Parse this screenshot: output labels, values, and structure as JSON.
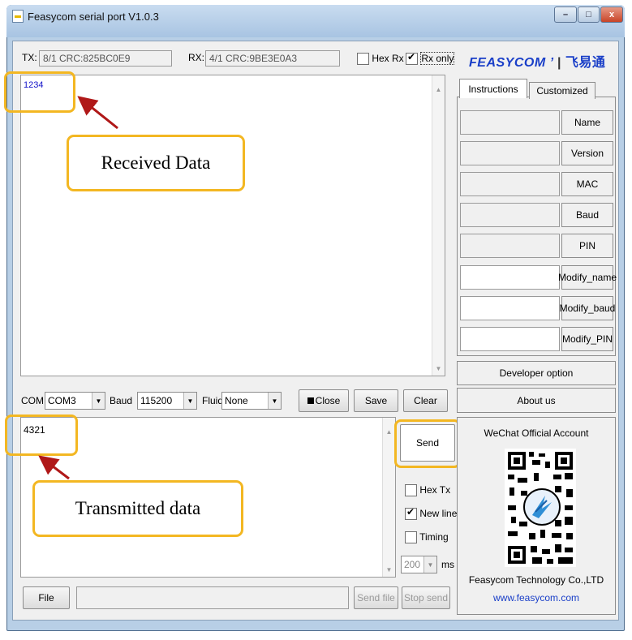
{
  "window": {
    "title": "Feasycom serial port V1.0.3",
    "min": "–",
    "max": "□",
    "close": "x"
  },
  "stats": {
    "tx_label": "TX:",
    "tx_value": "8/1 CRC:825BC0E9",
    "rx_label": "RX:",
    "rx_value": "4/1 CRC:9BE3E0A3",
    "hex_rx": "Hex Rx",
    "hex_rx_checked": false,
    "rx_only": "Rx only",
    "rx_only_checked": true
  },
  "brand": {
    "logo": "FEASYCOM",
    "logo_cn": "飞易通"
  },
  "received": {
    "text": "1234",
    "color": "#1010c8"
  },
  "transmit": {
    "text": "4321"
  },
  "serial": {
    "com_label": "COM",
    "com_value": "COM3",
    "baud_label": "Baud",
    "baud_value": "115200",
    "fluid_label": "Fluid",
    "fluid_value": "None",
    "close_btn": "Close",
    "save_btn": "Save",
    "clear_btn": "Clear"
  },
  "send": {
    "send_btn": "Send",
    "hex_tx": "Hex Tx",
    "hex_tx_checked": false,
    "new_line": "New line",
    "new_line_checked": true,
    "timing": "Timing",
    "timing_checked": false,
    "interval": "200",
    "unit": "ms"
  },
  "bottom": {
    "file_btn": "File",
    "send_file_btn": "Send file",
    "stop_send_btn": "Stop send"
  },
  "tabs": [
    "Instructions",
    "Customized"
  ],
  "instructions": [
    {
      "label": "Name"
    },
    {
      "label": "Version"
    },
    {
      "label": "MAC"
    },
    {
      "label": "Baud"
    },
    {
      "label": "PIN"
    },
    {
      "label": "Modify_name"
    },
    {
      "label": "Modify_baud"
    },
    {
      "label": "Modify_PIN"
    }
  ],
  "sidebar": {
    "developer": "Developer option",
    "about": "About us"
  },
  "wechat": {
    "title": "WeChat Official Account",
    "company": "Feasycom Technology Co.,LTD",
    "url": "www.feasycom.com",
    "url_color": "#1a3fc8"
  },
  "annotations": {
    "received": "Received Data",
    "transmitted": "Transmitted data",
    "accent": "#f3b722",
    "arrow": "#b01818"
  }
}
